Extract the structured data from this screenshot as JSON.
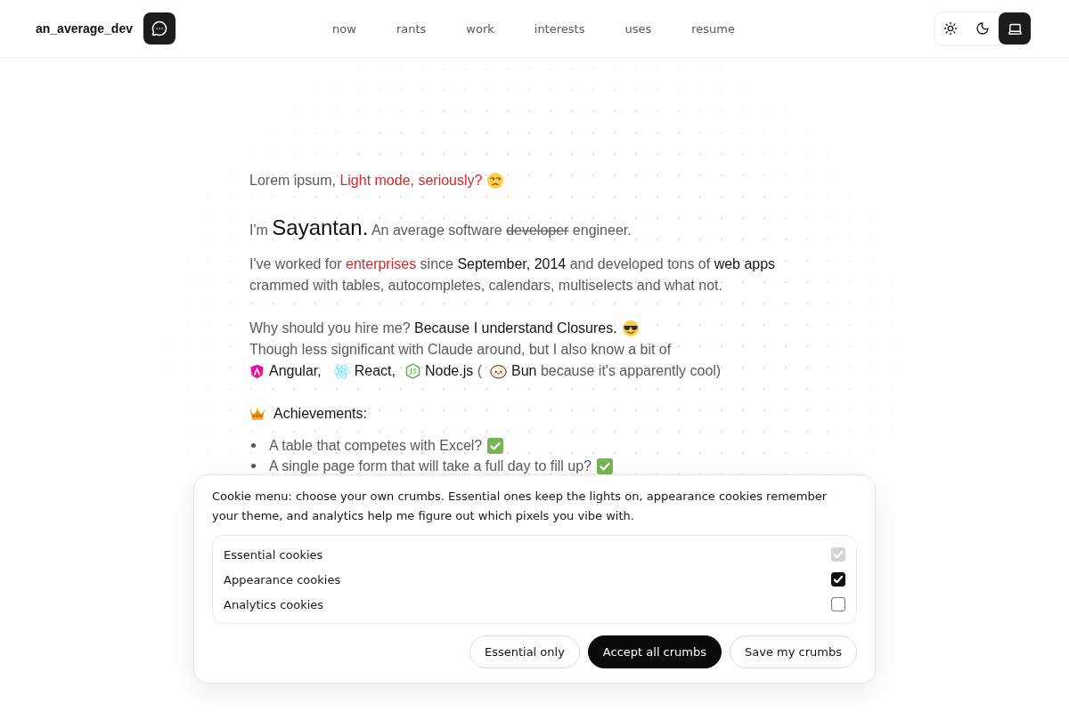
{
  "header": {
    "brand": "an_average_dev",
    "nav": [
      "now",
      "rants",
      "work",
      "interests",
      "uses",
      "resume"
    ],
    "theme_switch": [
      {
        "kind": "light",
        "selected": false
      },
      {
        "kind": "dark",
        "selected": false
      },
      {
        "kind": "system",
        "selected": true
      }
    ]
  },
  "intro": {
    "greeting": [
      {
        "text": "Lorem ipsum, ",
        "kind": "muted"
      },
      {
        "text": "Light mode, seriously?",
        "kind": "accent"
      }
    ],
    "headline": [
      {
        "text": "I'm ",
        "kind": "muted"
      },
      {
        "text": "Sayantan.",
        "kind": "name"
      },
      {
        "text": " An average software ",
        "kind": "muted"
      },
      {
        "text": "developer",
        "kind": "struck"
      },
      {
        "text": " engineer.",
        "kind": "muted"
      }
    ],
    "experience": [
      {
        "text": "I've worked for ",
        "kind": "muted"
      },
      {
        "text": "enterprises",
        "kind": "accent"
      },
      {
        "text": " since ",
        "kind": "muted"
      },
      {
        "text": "September, 2014",
        "kind": "strong"
      },
      {
        "text": " and developed tons of ",
        "kind": "muted"
      },
      {
        "text": "web apps",
        "kind": "strong"
      },
      {
        "text": " crammed with tables, autocompletes, calendars, multiselects and what not.",
        "kind": "muted"
      }
    ],
    "pitch": [
      {
        "text": "Why should you hire me? ",
        "kind": "muted"
      },
      {
        "text": "Because I understand Closures.",
        "kind": "strong"
      }
    ],
    "skills_note": [
      {
        "text": "Though less significant with Claude around, but I also know a bit of",
        "kind": "muted"
      }
    ],
    "stack": [
      {
        "kind": "angular",
        "segments": [
          {
            "text": "Angular,",
            "kind": "strong"
          }
        ]
      },
      {
        "kind": "react",
        "segments": [
          {
            "text": "React,",
            "kind": "strong"
          }
        ]
      },
      {
        "kind": "node",
        "segments": [
          {
            "text": "Node.js",
            "kind": "strong"
          },
          {
            "text": " (",
            "kind": "muted"
          }
        ]
      },
      {
        "kind": "bun",
        "segments": [
          {
            "text": "Bun",
            "kind": "strong"
          },
          {
            "text": " because it's apparently cool)",
            "kind": "muted"
          }
        ]
      }
    ],
    "achievements": {
      "heading": "Achievements:",
      "items": [
        "A table that competes with Excel?",
        "A single page form that will take a full day to fill up?"
      ]
    }
  },
  "cookie_dialog": {
    "message": "Cookie menu: choose your own crumbs. Essential ones keep the lights on, appearance cookies remember your theme, and analytics help me figure out which pixels you vibe with.",
    "options": [
      {
        "label": "Essential cookies",
        "checked": true,
        "disabled": true
      },
      {
        "label": "Appearance cookies",
        "checked": true,
        "disabled": false
      },
      {
        "label": "Analytics cookies",
        "checked": false,
        "disabled": false
      }
    ],
    "buttons": [
      {
        "label": "Essential only",
        "kind": "outline"
      },
      {
        "label": "Accept all crumbs",
        "kind": "primary"
      },
      {
        "label": "Save my crumbs",
        "kind": "outline"
      }
    ]
  }
}
